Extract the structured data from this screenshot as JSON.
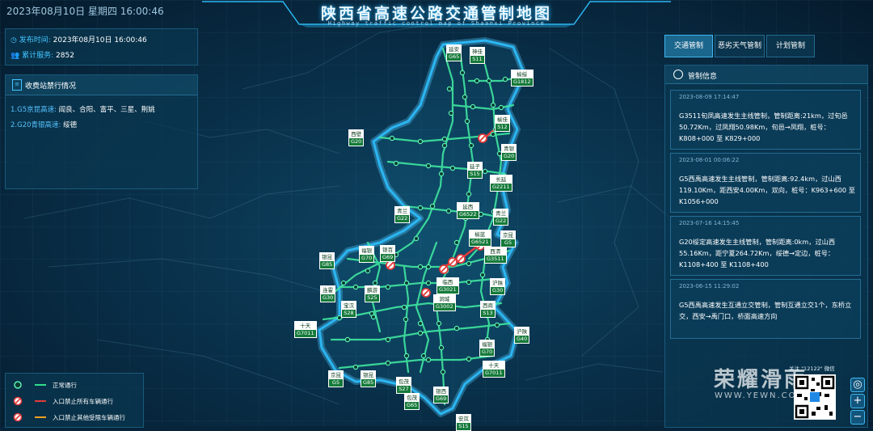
{
  "header": {
    "datetime": "2023年08月10日 星期四  16:00:46",
    "title": "陕西省高速公路交通管制地图",
    "subtitle": "Highway traffic control map of Shaanxi Province"
  },
  "info": {
    "publish_label": "发布时间:",
    "publish_value": "2023年08月10日 16:00:46",
    "service_label": "累计服务:",
    "service_value": "2852"
  },
  "toll": {
    "title": "收费站禁行情况",
    "lines": [
      {
        "label": "1.G5京昆高速:",
        "value": "阎良、合阳、富平、三星、荆姚"
      },
      {
        "label": "2.G20青银高速:",
        "value": "绥德"
      }
    ]
  },
  "tabs": [
    {
      "label": "交通管制",
      "active": true
    },
    {
      "label": "恶劣天气管制",
      "active": false
    },
    {
      "label": "计划管制",
      "active": false
    }
  ],
  "control": {
    "title": "管制信息",
    "cards": [
      {
        "date": "2023-08-09 17:14:47",
        "text": "G3511旬凤高速发生主线管制，管制距离:21km，过旬邑50.72Km，过凤翔50.98Km，旬邑→凤翔，桩号：K808+000 至 K829+000"
      },
      {
        "date": "2023-08-01 00:06:22",
        "text": "G5西禹高速发生主线管制，管制距离:92.4km，过山西119.10Km，距西安4.00Km，双向，桩号：K963+600 至 K1056+000"
      },
      {
        "date": "2023-07-16 14:15:45",
        "text": "G20绥定高速发生主线管制，管制距离:0km，过山西55.16Km，距宁夏264.72Km，绥德→定边，桩号：K1108+400 至 K1108+400"
      },
      {
        "date": "2023-06-15 11:29:02",
        "text": "G5西禹高速发生互通立交管制，管制互通立交1个，东桥立交，西安→禹门口，桥面高速方向"
      }
    ]
  },
  "legend": [
    {
      "icon": "normal-dot-icon",
      "line_color": "#2fe08a",
      "text": "正常通行"
    },
    {
      "icon": "no-entry-icon",
      "line_color": "#e23b3b",
      "text": "入口禁止所有车辆通行"
    },
    {
      "icon": "no-entry-icon",
      "line_color": "#f0a020",
      "text": "入口禁止其他受限车辆通行"
    }
  ],
  "controls": {
    "locate": "◎",
    "zoom_in": "+",
    "zoom_out": "−"
  },
  "qr": {
    "caption": "关注 \"12122\" 微信"
  },
  "watermark": {
    "main": "荣耀滑雨",
    "sub": "WWW.YEWN.COM"
  },
  "signs": [
    {
      "name": "延安",
      "code": "G65"
    },
    {
      "name": "神佳",
      "code": "S11"
    },
    {
      "name": "榆绥",
      "code": "G1812"
    },
    {
      "name": "榆佳",
      "code": "S12"
    },
    {
      "name": "青银",
      "code": "G20"
    },
    {
      "name": "西壁",
      "code": "G20"
    },
    {
      "name": "延子",
      "code": "S15"
    },
    {
      "name": "长延",
      "code": "G2211"
    },
    {
      "name": "延西",
      "code": "G6522"
    },
    {
      "name": "青兰",
      "code": "G22"
    },
    {
      "name": "青兰",
      "code": "G22"
    },
    {
      "name": "榆蓝",
      "code": "G6521"
    },
    {
      "name": "京昆",
      "code": "G5"
    },
    {
      "name": "银昆",
      "code": "G85"
    },
    {
      "name": "福银",
      "code": "G70"
    },
    {
      "name": "银百",
      "code": "G69"
    },
    {
      "name": "西渭",
      "code": "G3511"
    },
    {
      "name": "临西",
      "code": "G3021"
    },
    {
      "name": "沪陕",
      "code": "G30"
    },
    {
      "name": "连霍",
      "code": "G30"
    },
    {
      "name": "麟游",
      "code": "S25"
    },
    {
      "name": "宝汉",
      "code": "S28"
    },
    {
      "name": "洞城",
      "code": "G3002"
    },
    {
      "name": "西商",
      "code": "S13"
    },
    {
      "name": "十天",
      "code": "G7011"
    },
    {
      "name": "沪陕",
      "code": "G40"
    },
    {
      "name": "福银",
      "code": "G70"
    },
    {
      "name": "十天",
      "code": "G7011"
    },
    {
      "name": "京昆",
      "code": "G5"
    },
    {
      "name": "银昆",
      "code": "G85"
    },
    {
      "name": "包茂",
      "code": "S27"
    },
    {
      "name": "包茂",
      "code": "G65"
    },
    {
      "name": "银西",
      "code": "G69"
    },
    {
      "name": "安岚",
      "code": "S15"
    }
  ]
}
